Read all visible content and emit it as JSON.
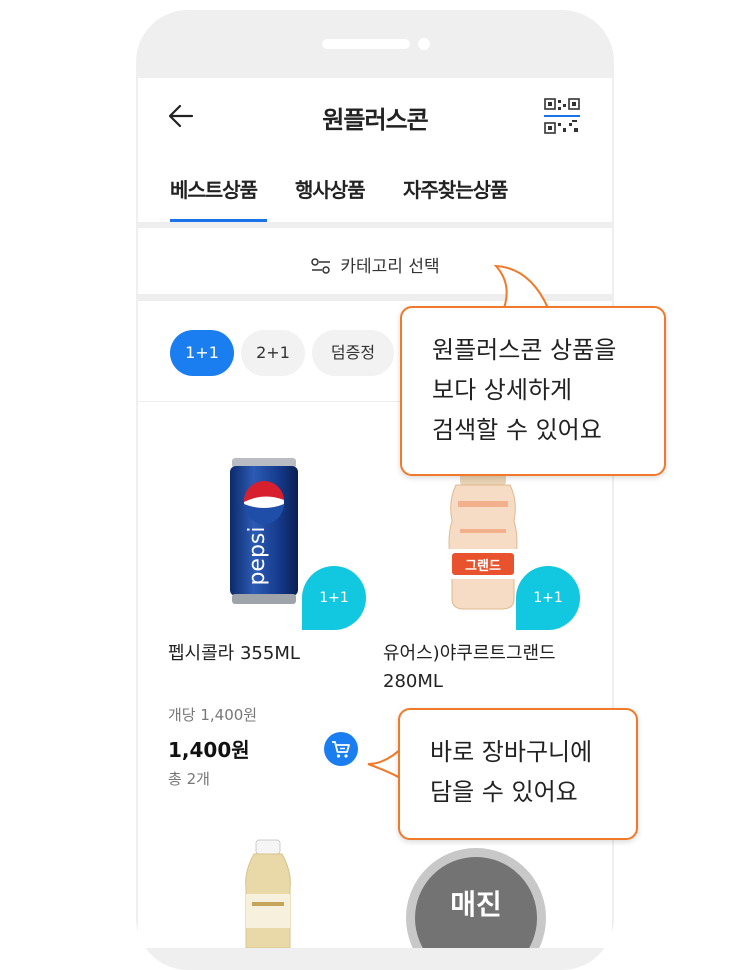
{
  "header": {
    "title": "원플러스콘",
    "back_icon": "arrow-left-icon",
    "qr_icon": "qr-code-icon"
  },
  "tabs": [
    {
      "label": "베스트상품",
      "active": true
    },
    {
      "label": "행사상품",
      "active": false
    },
    {
      "label": "자주찾는상품",
      "active": false
    }
  ],
  "category": {
    "label": "카테고리 선택",
    "icon": "filter-sliders-icon"
  },
  "chips": [
    {
      "label": "1+1",
      "active": true
    },
    {
      "label": "2+1",
      "active": false
    },
    {
      "label": "덤증정",
      "active": false
    }
  ],
  "products": [
    {
      "name": "펩시콜라 355ML",
      "badge": "1+1",
      "can_text": "pepsi"
    },
    {
      "name_lines": [
        "유어스)야쿠르트그랜드",
        "280ML"
      ],
      "badge": "1+1",
      "label_text": "그랜드"
    }
  ],
  "product_detail": {
    "unit_price": "개당 1,400원",
    "price": "1,400원",
    "total": "총 2개",
    "cart_icon": "cart-icon"
  },
  "sold_out": {
    "label": "매진"
  },
  "tooltips": [
    {
      "lines": [
        "원플러스콘 상품을",
        "보다 상세하게",
        "검색할 수 있어요"
      ]
    },
    {
      "lines": [
        "바로 장바구니에",
        "담을 수 있어요"
      ]
    }
  ],
  "colors": {
    "accent": "#1a7ef0",
    "badge": "#12c7e0",
    "tooltip_border": "#f07a2a"
  }
}
